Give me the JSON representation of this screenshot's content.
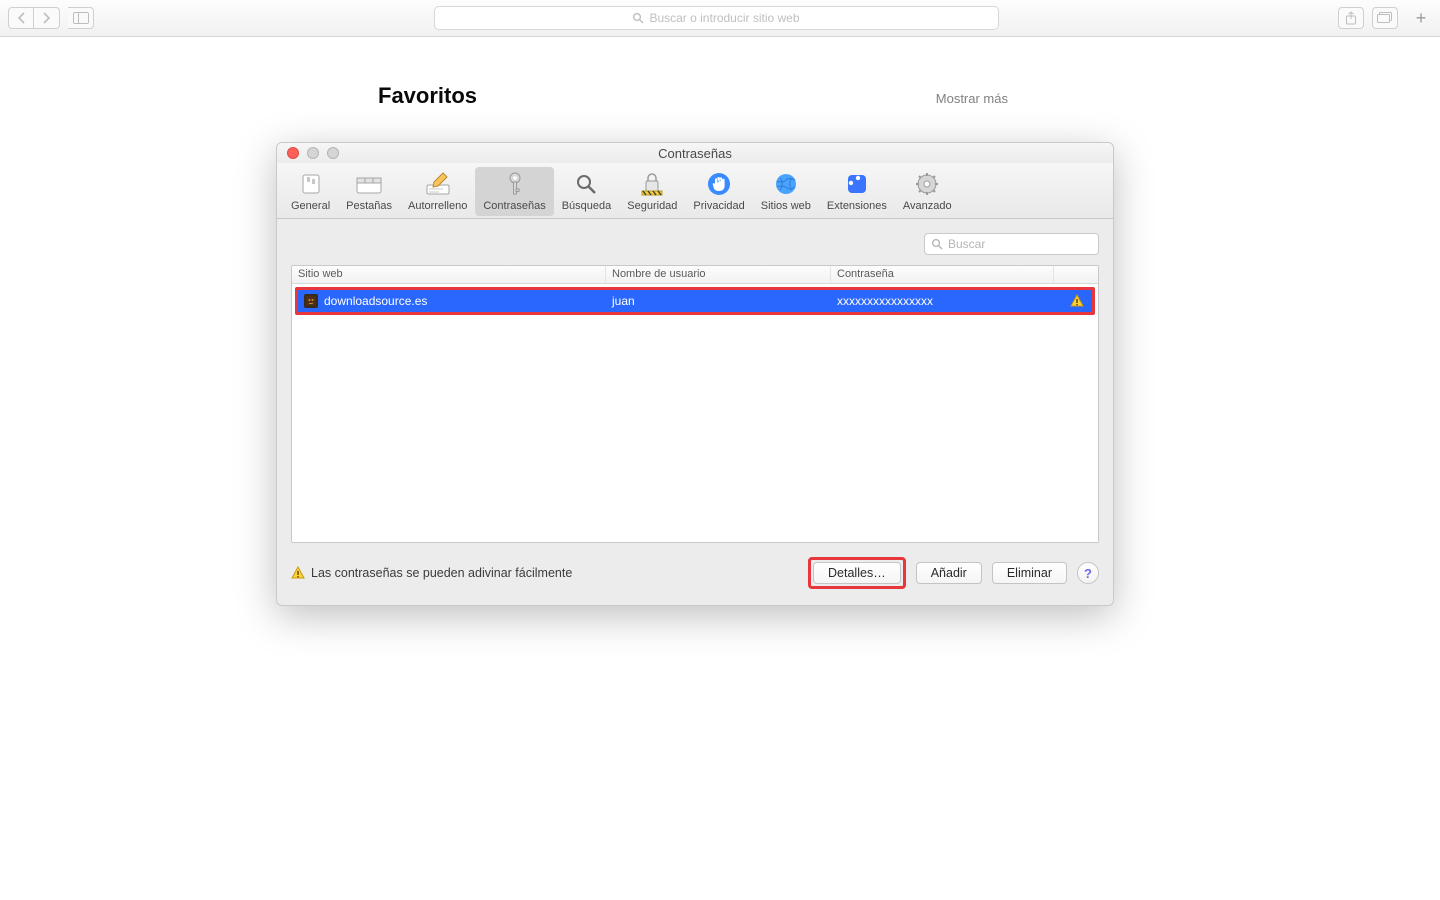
{
  "safari": {
    "address_placeholder": "Buscar o introducir sitio web"
  },
  "page": {
    "favorites_title": "Favoritos",
    "show_more": "Mostrar más"
  },
  "prefs": {
    "window_title": "Contraseñas",
    "tabs": {
      "general": "General",
      "tabs": "Pestañas",
      "autofill": "Autorrelleno",
      "passwords": "Contraseñas",
      "search": "Búsqueda",
      "security": "Seguridad",
      "privacy": "Privacidad",
      "websites": "Sitios web",
      "extensions": "Extensiones",
      "advanced": "Avanzado"
    },
    "search_placeholder": "Buscar",
    "columns": {
      "site": "Sitio web",
      "user": "Nombre de usuario",
      "pass": "Contraseña"
    },
    "rows": [
      {
        "site": "downloadsource.es",
        "user": "juan",
        "pass": "xxxxxxxxxxxxxxxx"
      }
    ],
    "warning_msg": "Las contraseñas se pueden adivinar fácilmente",
    "buttons": {
      "details": "Detalles…",
      "add": "Añadir",
      "remove": "Eliminar"
    }
  }
}
